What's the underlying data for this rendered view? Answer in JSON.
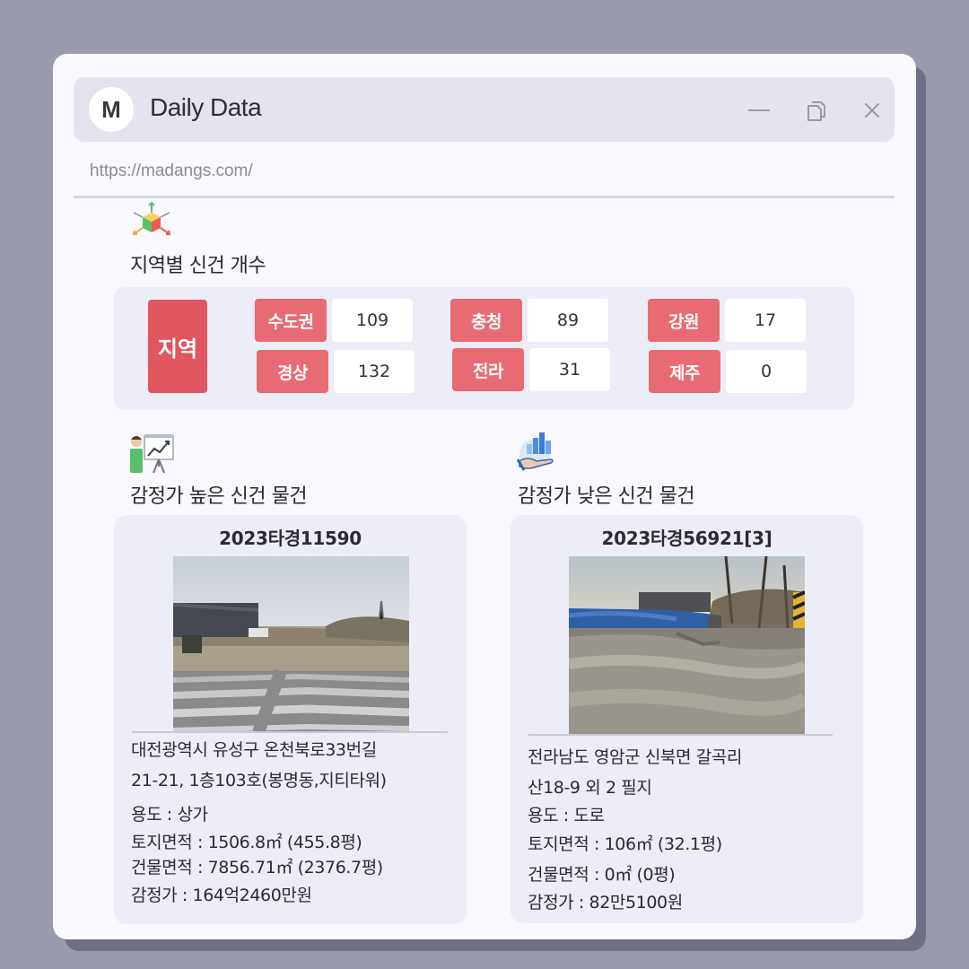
{
  "window": {
    "avatar_letter": "M",
    "title": "Daily Data",
    "url": "https://madangs.com/"
  },
  "region_section": {
    "icon": "cube-axes-icon",
    "title": "지역별 신건 개수",
    "group_label": "지역",
    "regions": [
      {
        "name": "수도권",
        "count": "109"
      },
      {
        "name": "충청",
        "count": "89"
      },
      {
        "name": "강원",
        "count": "17"
      },
      {
        "name": "경상",
        "count": "132"
      },
      {
        "name": "전라",
        "count": "31"
      },
      {
        "name": "제주",
        "count": "0"
      }
    ]
  },
  "high_section": {
    "icon": "presentation-chart-icon",
    "title": "감정가 높은 신건 물건",
    "case_no": "2023타경11590",
    "address_line1": "대전광역시 유성구 온천북로33번길",
    "address_line2": "21-21, 1층103호(봉명동,지티타워)",
    "usage": "용도 : 상가",
    "land_area": "토지면적 : 1506.8㎡ (455.8평)",
    "building_area": "건물면적 : 7856.71㎡ (2376.7평)",
    "appraisal": "감정가 : 164억2460만원"
  },
  "low_section": {
    "icon": "hand-bar-chart-icon",
    "title": "감정가 낮은 신건 물건",
    "case_no": "2023타경56921[3]",
    "address_line1": "전라남도 영암군 신북면 갈곡리",
    "address_line2": "산18-9 외 2 필지",
    "usage": "용도 : 도로",
    "land_area": "토지면적 : 106㎡ (32.1평)",
    "building_area": "건물면적 : 0㎡ (0평)",
    "appraisal": "감정가 : 82만5100원"
  },
  "colors": {
    "background": "#999aab",
    "window": "#f8f8fe",
    "panel": "#ecedf7",
    "accent_red": "#e0575f",
    "label_red": "#e86a72"
  }
}
